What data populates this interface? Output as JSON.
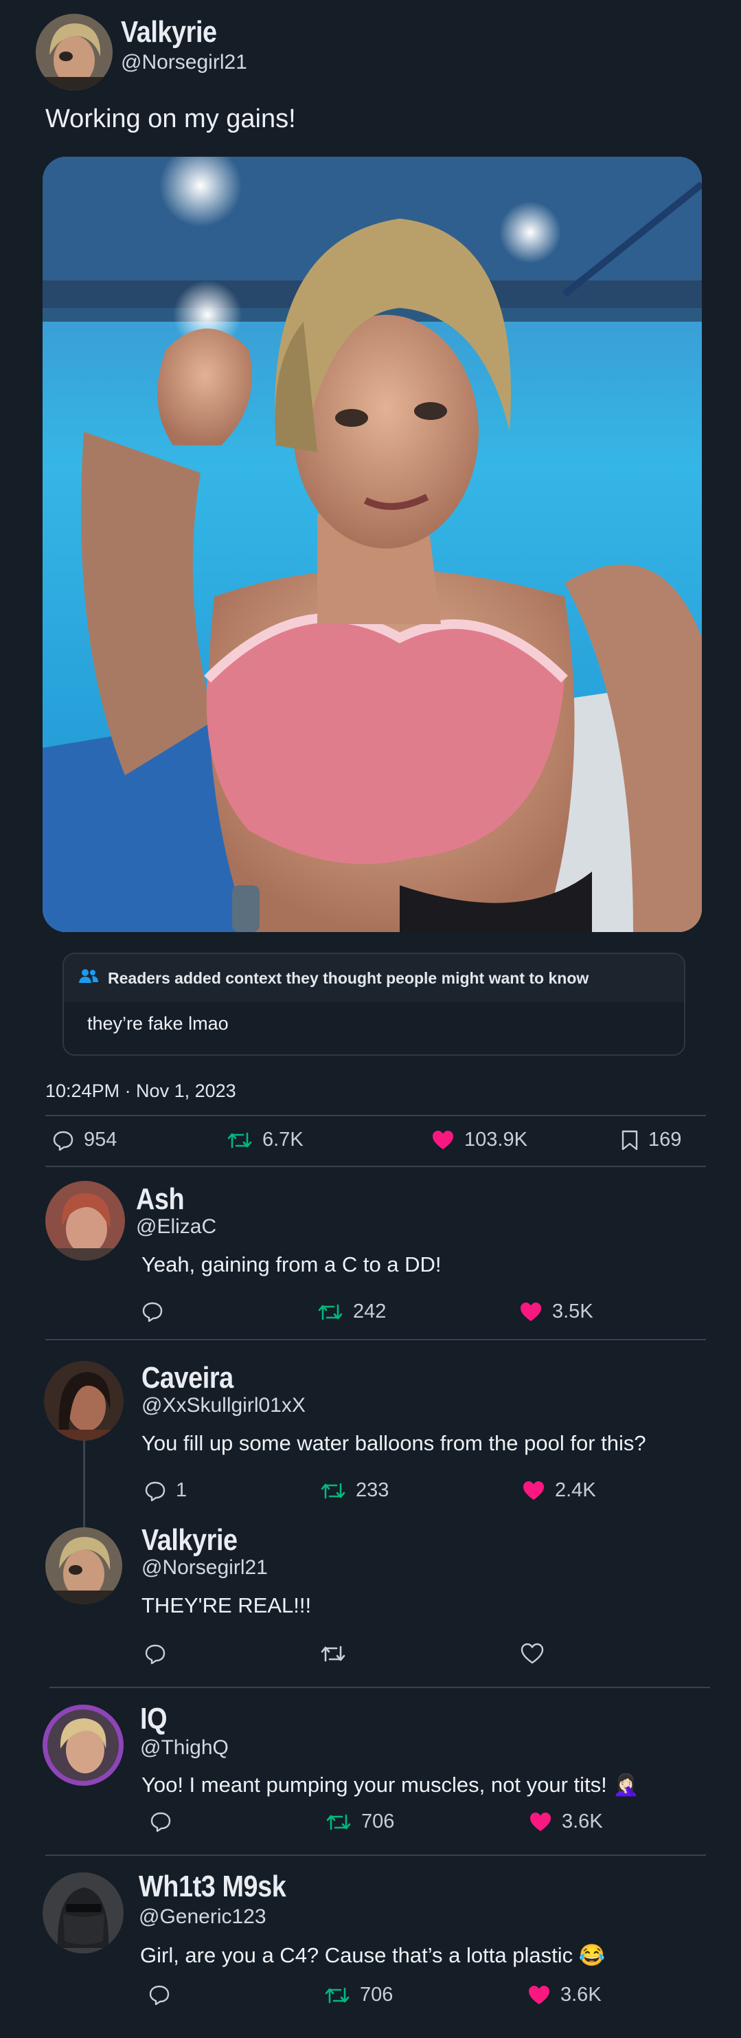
{
  "tweet": {
    "author_name": "Valkyrie",
    "author_handle": "@Norsegirl21",
    "text": "Working on my gains!",
    "timestamp": "10:24PM · Nov 1, 2023",
    "context_header": "Readers added context they thought people might want to know",
    "context_text": "they’re fake lmao",
    "stats": {
      "replies": "954",
      "retweets": "6.7K",
      "likes": "103.9K",
      "bookmarks": "169"
    }
  },
  "replies": [
    {
      "name": "Ash",
      "handle": "@ElizaC",
      "text": "Yeah, gaining from a C to a DD!",
      "replies": "",
      "retweets": "242",
      "likes": "3.5K"
    },
    {
      "name": "Caveira",
      "handle": "@XxSkullgirl01xX",
      "text": "You fill up some water balloons from the pool for this?",
      "replies": "1",
      "retweets": "233",
      "likes": "2.4K"
    },
    {
      "name": "Valkyrie",
      "handle": "@Norsegirl21",
      "text": "THEY'RE REAL!!!",
      "replies": "",
      "retweets": "",
      "likes": ""
    },
    {
      "name": "IQ",
      "handle": "@ThighQ",
      "text": "Yoo! I meant pumping your muscles, not your tits! 🤦🏻‍♀️",
      "replies": "",
      "retweets": "706",
      "likes": "3.6K"
    },
    {
      "name": "Wh1t3 M9sk",
      "handle": "@Generic123",
      "text": "Girl, are you a C4? Cause that’s a lotta plastic 😂",
      "replies": "",
      "retweets": "706",
      "likes": "3.6K"
    }
  ],
  "colors": {
    "background": "#151d27",
    "like": "#f91880",
    "retweet": "#00ba7c",
    "divider": "#3a434d"
  },
  "icons": [
    "reply-icon",
    "retweet-icon",
    "like-icon",
    "bookmark-icon",
    "people-icon"
  ]
}
